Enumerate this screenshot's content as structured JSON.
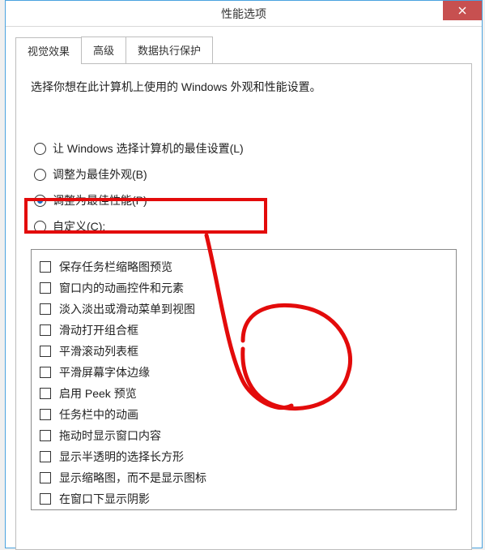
{
  "window": {
    "title": "性能选项"
  },
  "tabs": {
    "items": [
      {
        "label": "视觉效果"
      },
      {
        "label": "高级"
      },
      {
        "label": "数据执行保护"
      }
    ]
  },
  "description": "选择你想在此计算机上使用的 Windows 外观和性能设置。",
  "radios": {
    "options": [
      {
        "label": "让 Windows 选择计算机的最佳设置(L)",
        "checked": false
      },
      {
        "label": "调整为最佳外观(B)",
        "checked": false
      },
      {
        "label": "调整为最佳性能(P)",
        "checked": true
      },
      {
        "label": "自定义(C):",
        "checked": false
      }
    ]
  },
  "checkboxes": {
    "items": [
      {
        "label": "保存任务栏缩略图预览"
      },
      {
        "label": "窗口内的动画控件和元素"
      },
      {
        "label": "淡入淡出或滑动菜单到视图"
      },
      {
        "label": "滑动打开组合框"
      },
      {
        "label": "平滑滚动列表框"
      },
      {
        "label": "平滑屏幕字体边缘"
      },
      {
        "label": "启用 Peek 预览"
      },
      {
        "label": "任务栏中的动画"
      },
      {
        "label": "拖动时显示窗口内容"
      },
      {
        "label": "显示半透明的选择长方形"
      },
      {
        "label": "显示缩略图，而不是显示图标"
      },
      {
        "label": "在窗口下显示阴影"
      }
    ]
  },
  "colors": {
    "annotation": "#e30b0b",
    "close": "#c75050",
    "border": "#4aa3df"
  }
}
